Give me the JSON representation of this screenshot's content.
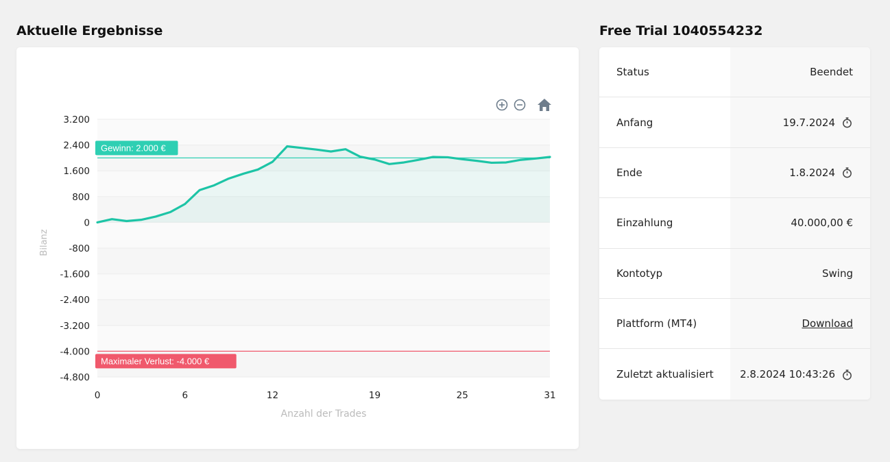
{
  "left_section": {
    "title": "Aktuelle Ergebnisse"
  },
  "right_section": {
    "title": "Free Trial 1040554232"
  },
  "toolbar": {
    "icons": [
      "zoom-in-icon",
      "zoom-out-icon",
      "home-icon"
    ]
  },
  "chart_data": {
    "type": "area",
    "xlabel": "Anzahl der Trades",
    "ylabel": "Bilanz",
    "x_ticks": [
      "0",
      "6",
      "12",
      "19",
      "25",
      "31"
    ],
    "y_ticks": [
      "3.200",
      "2.400",
      "1.600",
      "800",
      "0",
      "-800",
      "-1.600",
      "-2.400",
      "-3.200",
      "-4.000",
      "-4.800"
    ],
    "xlim": [
      0,
      31
    ],
    "ylim": [
      -4800,
      3200
    ],
    "grid": true,
    "x": [
      0,
      1,
      2,
      3,
      4,
      5,
      6,
      7,
      8,
      9,
      10,
      11,
      12,
      13,
      14,
      15,
      16,
      17,
      18,
      19,
      20,
      21,
      22,
      23,
      24,
      25,
      26,
      27,
      28,
      29,
      30,
      31
    ],
    "values": [
      0,
      100,
      40,
      80,
      180,
      320,
      570,
      1000,
      1150,
      1360,
      1510,
      1640,
      1880,
      2360,
      2310,
      2260,
      2200,
      2270,
      2040,
      1950,
      1810,
      1860,
      1940,
      2030,
      2020,
      1960,
      1910,
      1850,
      1860,
      1940,
      1980,
      2030
    ],
    "series_color": "#1dc4a6",
    "annotations": [
      {
        "label": "Gewinn: 2.000 €",
        "value": 2000,
        "color": "#2ecfb3"
      },
      {
        "label": "Maximaler Verlust: -4.000 €",
        "value": -4000,
        "color": "#f0596c"
      }
    ]
  },
  "info_rows": [
    {
      "label": "Status",
      "value": "Beendet",
      "icon": "",
      "link": false
    },
    {
      "label": "Anfang",
      "value": "19.7.2024",
      "icon": "timer-icon",
      "link": false
    },
    {
      "label": "Ende",
      "value": "1.8.2024",
      "icon": "timer-icon",
      "link": false
    },
    {
      "label": "Einzahlung",
      "value": "40.000,00 €",
      "icon": "",
      "link": false
    },
    {
      "label": "Kontotyp",
      "value": "Swing",
      "icon": "",
      "link": false
    },
    {
      "label": "Plattform (MT4)",
      "value": "Download",
      "icon": "",
      "link": true
    },
    {
      "label": "Zuletzt aktualisiert",
      "value": "2.8.2024 10:43:26",
      "icon": "timer-icon",
      "link": false
    }
  ]
}
